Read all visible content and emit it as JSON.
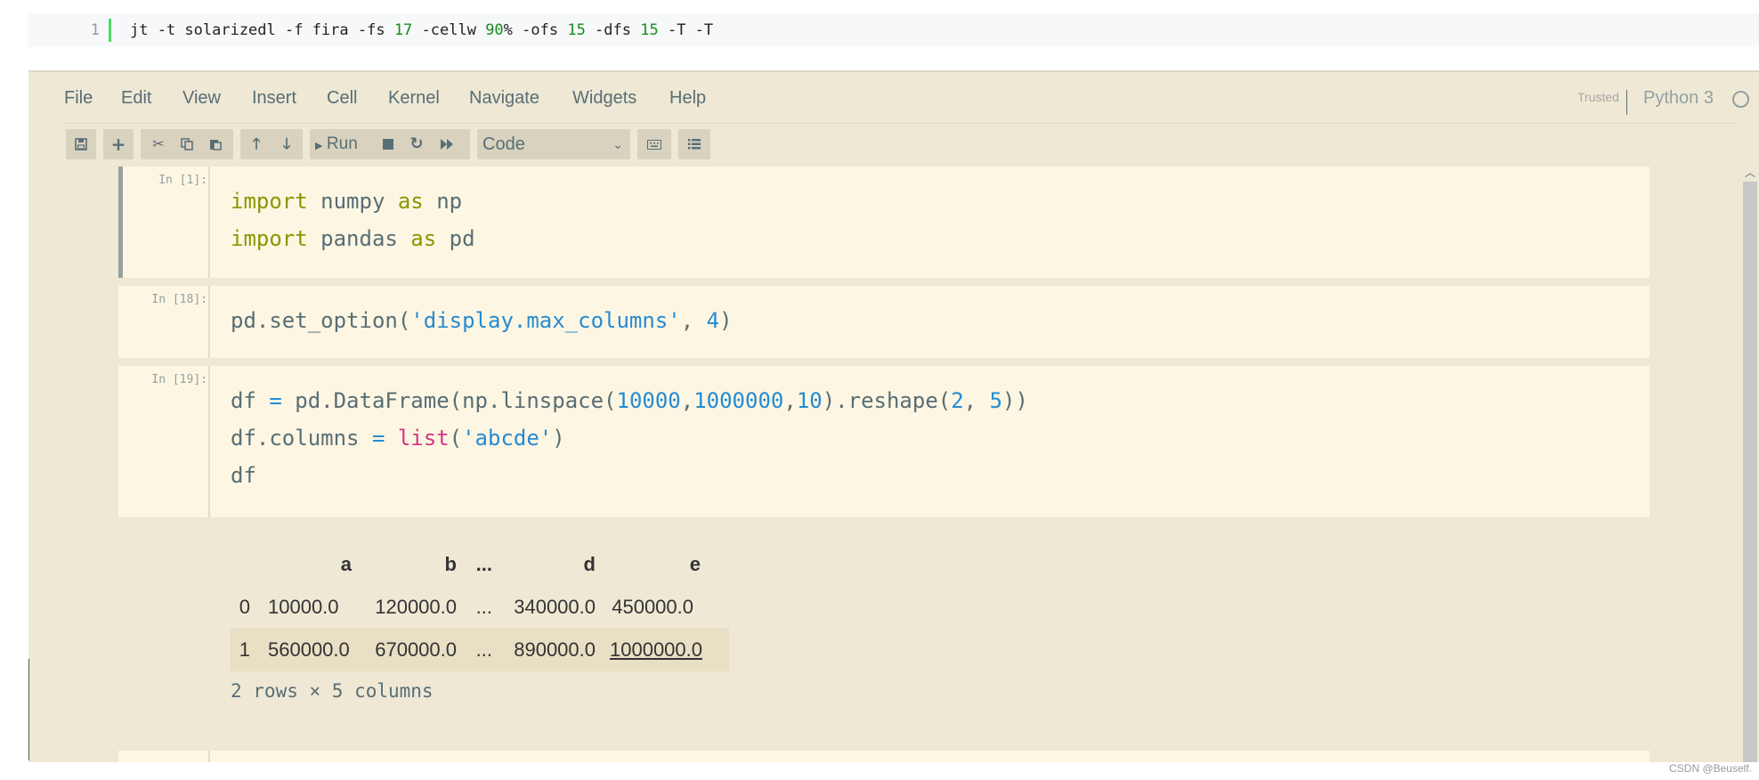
{
  "command_block": {
    "line_number": "1",
    "tokens": [
      {
        "text": "jt -t solarizedl -f fira -fs ",
        "type": "plain"
      },
      {
        "text": "17",
        "type": "num"
      },
      {
        "text": " -cellw ",
        "type": "plain"
      },
      {
        "text": "90",
        "type": "num"
      },
      {
        "text": "% -ofs ",
        "type": "plain"
      },
      {
        "text": "15",
        "type": "num"
      },
      {
        "text": " -dfs ",
        "type": "plain"
      },
      {
        "text": "15",
        "type": "num"
      },
      {
        "text": " -T -T",
        "type": "plain"
      }
    ]
  },
  "menu": {
    "items": [
      "File",
      "Edit",
      "View",
      "Insert",
      "Cell",
      "Kernel",
      "Navigate",
      "Widgets",
      "Help"
    ],
    "trusted": "Trusted",
    "kernel": "Python 3"
  },
  "toolbar": {
    "run_label": "Run",
    "cell_type": "Code",
    "icons": [
      "save-icon",
      "plus-icon",
      "cut-icon",
      "copy-icon",
      "paste-icon",
      "arrow-up-icon",
      "arrow-down-icon",
      "run-icon",
      "stop-icon",
      "restart-icon",
      "fast-forward-icon",
      "keyboard-icon",
      "list-icon"
    ]
  },
  "cells": [
    {
      "prompt": "In [1]:",
      "selected": true,
      "lines": [
        [
          {
            "t": "import",
            "c": "kw"
          },
          {
            "t": " numpy ",
            "c": ""
          },
          {
            "t": "as",
            "c": "kw"
          },
          {
            "t": " np",
            "c": ""
          }
        ],
        [
          {
            "t": "import",
            "c": "kw"
          },
          {
            "t": " pandas ",
            "c": ""
          },
          {
            "t": "as",
            "c": "kw"
          },
          {
            "t": " pd",
            "c": ""
          }
        ]
      ]
    },
    {
      "prompt": "In [18]:",
      "selected": false,
      "lines": [
        [
          {
            "t": "pd.set_option(",
            "c": ""
          },
          {
            "t": "'display.max_columns'",
            "c": "str"
          },
          {
            "t": ", ",
            "c": ""
          },
          {
            "t": "4",
            "c": "num"
          },
          {
            "t": ")",
            "c": ""
          }
        ]
      ]
    },
    {
      "prompt": "In [19]:",
      "selected": false,
      "lines": [
        [
          {
            "t": "df ",
            "c": ""
          },
          {
            "t": "=",
            "c": "op"
          },
          {
            "t": " pd.DataFrame(np.linspace(",
            "c": ""
          },
          {
            "t": "10000",
            "c": "num"
          },
          {
            "t": ",",
            "c": ""
          },
          {
            "t": "1000000",
            "c": "num"
          },
          {
            "t": ",",
            "c": ""
          },
          {
            "t": "10",
            "c": "num"
          },
          {
            "t": ").reshape(",
            "c": ""
          },
          {
            "t": "2",
            "c": "num"
          },
          {
            "t": ", ",
            "c": ""
          },
          {
            "t": "5",
            "c": "num"
          },
          {
            "t": "))",
            "c": ""
          }
        ],
        [
          {
            "t": "df.columns ",
            "c": ""
          },
          {
            "t": "=",
            "c": "op"
          },
          {
            "t": " ",
            "c": ""
          },
          {
            "t": "list",
            "c": "bi"
          },
          {
            "t": "(",
            "c": ""
          },
          {
            "t": "'abcde'",
            "c": "str"
          },
          {
            "t": ")",
            "c": ""
          }
        ],
        [
          {
            "t": "df",
            "c": ""
          }
        ]
      ]
    }
  ],
  "output": {
    "columns": [
      "",
      "a",
      "b",
      "...",
      "d",
      "e"
    ],
    "rows": [
      [
        "0",
        "10000.0",
        "120000.0",
        "...",
        "340000.0",
        "450000.0"
      ],
      [
        "1",
        "560000.0",
        "670000.0",
        "...",
        "890000.0",
        "1000000.0"
      ]
    ],
    "shape": "2 rows × 5 columns"
  },
  "watermark": "CSDN @Beuself."
}
